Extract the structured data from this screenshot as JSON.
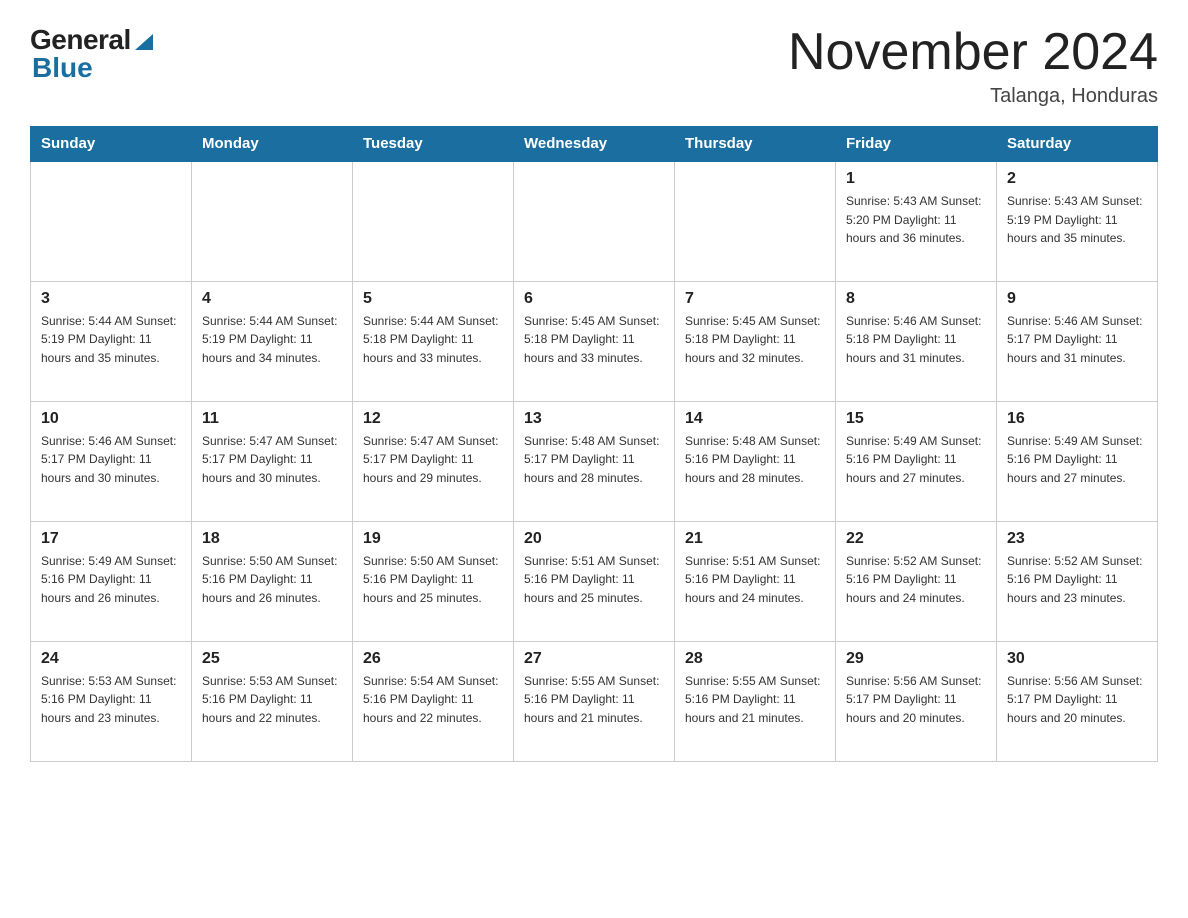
{
  "header": {
    "logo_general": "General",
    "logo_blue": "Blue",
    "title": "November 2024",
    "location": "Talanga, Honduras"
  },
  "days_of_week": [
    "Sunday",
    "Monday",
    "Tuesday",
    "Wednesday",
    "Thursday",
    "Friday",
    "Saturday"
  ],
  "weeks": [
    [
      {
        "day": "",
        "info": ""
      },
      {
        "day": "",
        "info": ""
      },
      {
        "day": "",
        "info": ""
      },
      {
        "day": "",
        "info": ""
      },
      {
        "day": "",
        "info": ""
      },
      {
        "day": "1",
        "info": "Sunrise: 5:43 AM\nSunset: 5:20 PM\nDaylight: 11 hours and 36 minutes."
      },
      {
        "day": "2",
        "info": "Sunrise: 5:43 AM\nSunset: 5:19 PM\nDaylight: 11 hours and 35 minutes."
      }
    ],
    [
      {
        "day": "3",
        "info": "Sunrise: 5:44 AM\nSunset: 5:19 PM\nDaylight: 11 hours and 35 minutes."
      },
      {
        "day": "4",
        "info": "Sunrise: 5:44 AM\nSunset: 5:19 PM\nDaylight: 11 hours and 34 minutes."
      },
      {
        "day": "5",
        "info": "Sunrise: 5:44 AM\nSunset: 5:18 PM\nDaylight: 11 hours and 33 minutes."
      },
      {
        "day": "6",
        "info": "Sunrise: 5:45 AM\nSunset: 5:18 PM\nDaylight: 11 hours and 33 minutes."
      },
      {
        "day": "7",
        "info": "Sunrise: 5:45 AM\nSunset: 5:18 PM\nDaylight: 11 hours and 32 minutes."
      },
      {
        "day": "8",
        "info": "Sunrise: 5:46 AM\nSunset: 5:18 PM\nDaylight: 11 hours and 31 minutes."
      },
      {
        "day": "9",
        "info": "Sunrise: 5:46 AM\nSunset: 5:17 PM\nDaylight: 11 hours and 31 minutes."
      }
    ],
    [
      {
        "day": "10",
        "info": "Sunrise: 5:46 AM\nSunset: 5:17 PM\nDaylight: 11 hours and 30 minutes."
      },
      {
        "day": "11",
        "info": "Sunrise: 5:47 AM\nSunset: 5:17 PM\nDaylight: 11 hours and 30 minutes."
      },
      {
        "day": "12",
        "info": "Sunrise: 5:47 AM\nSunset: 5:17 PM\nDaylight: 11 hours and 29 minutes."
      },
      {
        "day": "13",
        "info": "Sunrise: 5:48 AM\nSunset: 5:17 PM\nDaylight: 11 hours and 28 minutes."
      },
      {
        "day": "14",
        "info": "Sunrise: 5:48 AM\nSunset: 5:16 PM\nDaylight: 11 hours and 28 minutes."
      },
      {
        "day": "15",
        "info": "Sunrise: 5:49 AM\nSunset: 5:16 PM\nDaylight: 11 hours and 27 minutes."
      },
      {
        "day": "16",
        "info": "Sunrise: 5:49 AM\nSunset: 5:16 PM\nDaylight: 11 hours and 27 minutes."
      }
    ],
    [
      {
        "day": "17",
        "info": "Sunrise: 5:49 AM\nSunset: 5:16 PM\nDaylight: 11 hours and 26 minutes."
      },
      {
        "day": "18",
        "info": "Sunrise: 5:50 AM\nSunset: 5:16 PM\nDaylight: 11 hours and 26 minutes."
      },
      {
        "day": "19",
        "info": "Sunrise: 5:50 AM\nSunset: 5:16 PM\nDaylight: 11 hours and 25 minutes."
      },
      {
        "day": "20",
        "info": "Sunrise: 5:51 AM\nSunset: 5:16 PM\nDaylight: 11 hours and 25 minutes."
      },
      {
        "day": "21",
        "info": "Sunrise: 5:51 AM\nSunset: 5:16 PM\nDaylight: 11 hours and 24 minutes."
      },
      {
        "day": "22",
        "info": "Sunrise: 5:52 AM\nSunset: 5:16 PM\nDaylight: 11 hours and 24 minutes."
      },
      {
        "day": "23",
        "info": "Sunrise: 5:52 AM\nSunset: 5:16 PM\nDaylight: 11 hours and 23 minutes."
      }
    ],
    [
      {
        "day": "24",
        "info": "Sunrise: 5:53 AM\nSunset: 5:16 PM\nDaylight: 11 hours and 23 minutes."
      },
      {
        "day": "25",
        "info": "Sunrise: 5:53 AM\nSunset: 5:16 PM\nDaylight: 11 hours and 22 minutes."
      },
      {
        "day": "26",
        "info": "Sunrise: 5:54 AM\nSunset: 5:16 PM\nDaylight: 11 hours and 22 minutes."
      },
      {
        "day": "27",
        "info": "Sunrise: 5:55 AM\nSunset: 5:16 PM\nDaylight: 11 hours and 21 minutes."
      },
      {
        "day": "28",
        "info": "Sunrise: 5:55 AM\nSunset: 5:16 PM\nDaylight: 11 hours and 21 minutes."
      },
      {
        "day": "29",
        "info": "Sunrise: 5:56 AM\nSunset: 5:17 PM\nDaylight: 11 hours and 20 minutes."
      },
      {
        "day": "30",
        "info": "Sunrise: 5:56 AM\nSunset: 5:17 PM\nDaylight: 11 hours and 20 minutes."
      }
    ]
  ]
}
